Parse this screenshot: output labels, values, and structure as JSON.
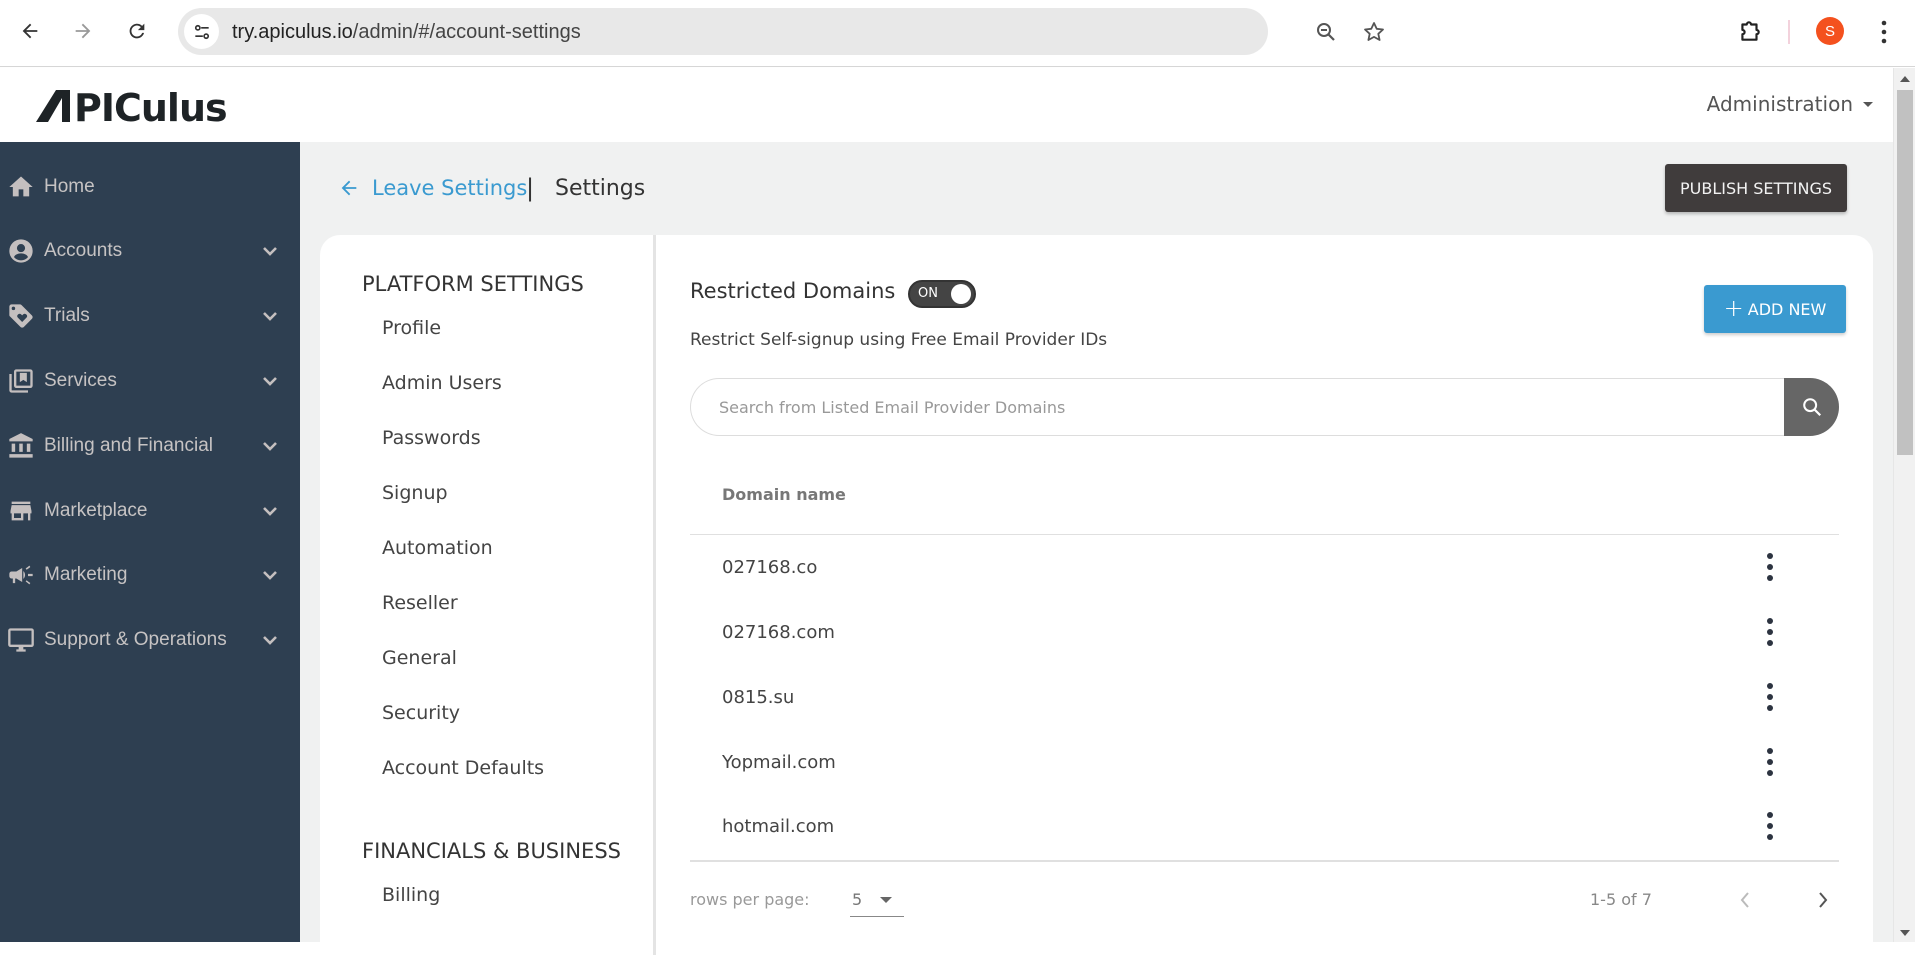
{
  "browser": {
    "url_host": "try.apiculus.io",
    "url_path": "/admin/#/account-settings",
    "profile_initial": "S",
    "profile_color": "#f4511e"
  },
  "header": {
    "logo": "APICULUS",
    "admin_menu": "Administration"
  },
  "sidebar": {
    "items": [
      {
        "label": "Home",
        "icon": "home-icon",
        "expandable": false
      },
      {
        "label": "Accounts",
        "icon": "account-circle-icon",
        "expandable": true
      },
      {
        "label": "Trials",
        "icon": "tag-heart-icon",
        "expandable": true
      },
      {
        "label": "Services",
        "icon": "library-bookmark-icon",
        "expandable": true
      },
      {
        "label": "Billing and Financial",
        "icon": "bank-icon",
        "expandable": true
      },
      {
        "label": "Marketplace",
        "icon": "storefront-icon",
        "expandable": true
      },
      {
        "label": "Marketing",
        "icon": "megaphone-icon",
        "expandable": true
      },
      {
        "label": "Support & Operations",
        "icon": "monitor-icon",
        "expandable": true
      }
    ]
  },
  "breadcrumb": {
    "back_label": "Leave Settings",
    "separator": "|",
    "current": "Settings"
  },
  "toolbar": {
    "publish_label": "PUBLISH SETTINGS"
  },
  "settings_nav": {
    "sections": [
      {
        "heading": "PLATFORM SETTINGS",
        "items": [
          "Profile",
          "Admin Users",
          "Passwords",
          "Signup",
          "Automation",
          "Reseller",
          "General",
          "Security",
          "Account Defaults"
        ]
      },
      {
        "heading": "FINANCIALS & BUSINESS",
        "items": [
          "Billing"
        ]
      }
    ]
  },
  "restricted_domains": {
    "title": "Restricted Domains",
    "toggle_label": "ON",
    "toggle_on": true,
    "description": "Restrict Self-signup using Free Email Provider IDs",
    "add_new_label": "ADD NEW",
    "search_placeholder": "Search from Listed Email Provider Domains",
    "search_value": "",
    "column_header": "Domain name",
    "rows": [
      "027168.co",
      "027168.com",
      "0815.su",
      "Yopmail.com",
      "hotmail.com"
    ],
    "pagination": {
      "rows_per_page_label": "rows per page:",
      "rows_per_page": "5",
      "range": "1-5 of 7"
    },
    "colors": {
      "accent": "#3a9ad0",
      "publish_bg": "#403c3c",
      "sidebar_bg": "#2e3f51"
    }
  }
}
